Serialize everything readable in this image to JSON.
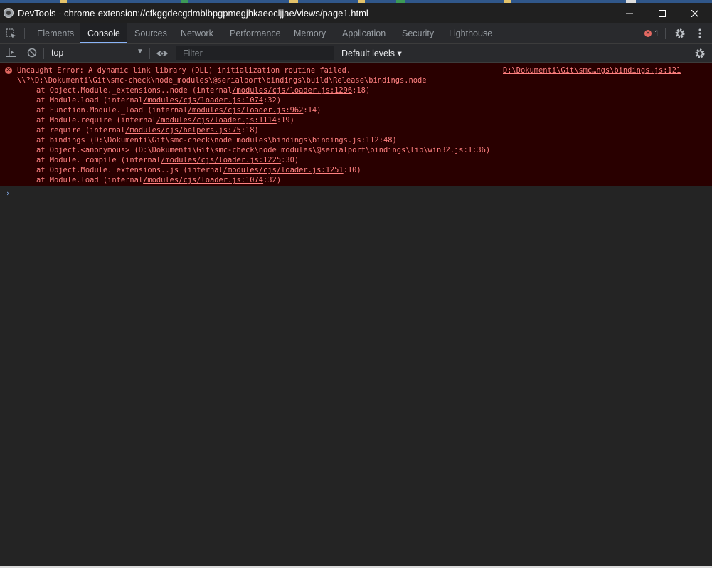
{
  "window": {
    "title": "DevTools - chrome-extension://cfkggdecgdmblbpgpmegjhkaeocljjae/views/page1.html",
    "minimize_symbol": "—",
    "maximize_symbol": "☐",
    "close_symbol": "✕"
  },
  "tabs": [
    {
      "label": "Elements"
    },
    {
      "label": "Console",
      "active": true
    },
    {
      "label": "Sources"
    },
    {
      "label": "Network"
    },
    {
      "label": "Performance"
    },
    {
      "label": "Memory"
    },
    {
      "label": "Application"
    },
    {
      "label": "Security"
    },
    {
      "label": "Lighthouse"
    }
  ],
  "error_count": "1",
  "toolbar": {
    "context": "top",
    "filter_placeholder": "Filter",
    "levels_label": "Default levels ▾"
  },
  "console": {
    "error_message": "Uncaught Error: A dynamic link library (DLL) initialization routine failed.",
    "error_path": "\\\\?\\D:\\Dokumenti\\Git\\smc-check\\node_modules\\@serialport\\bindings\\build\\Release\\bindings.node",
    "source_link": "D:\\Dokumenti\\Git\\smc…ngs\\bindings.js:121",
    "stack": [
      {
        "pre": "at Object.Module._extensions..node (internal",
        "link": "/modules/cjs/loader.js:1296",
        "post": ":18)"
      },
      {
        "pre": "at Module.load (internal",
        "link": "/modules/cjs/loader.js:1074",
        "post": ":32)"
      },
      {
        "pre": "at Function.Module._load (internal",
        "link": "/modules/cjs/loader.js:962",
        "post": ":14)"
      },
      {
        "pre": "at Module.require (internal",
        "link": "/modules/cjs/loader.js:1114",
        "post": ":19)"
      },
      {
        "pre": "at require (internal",
        "link": "/modules/cjs/helpers.js:75",
        "post": ":18)"
      },
      {
        "pre": "at bindings (D:\\Dokumenti\\Git\\smc-check\\node_modules\\bindings\\bindings.js:112:48)",
        "link": "",
        "post": ""
      },
      {
        "pre": "at Object.<anonymous> (D:\\Dokumenti\\Git\\smc-check\\node_modules\\@serialport\\bindings\\lib\\win32.js:1:36)",
        "link": "",
        "post": ""
      },
      {
        "pre": "at Module._compile (internal",
        "link": "/modules/cjs/loader.js:1225",
        "post": ":30)"
      },
      {
        "pre": "at Object.Module._extensions..js (internal",
        "link": "/modules/cjs/loader.js:1251",
        "post": ":10)"
      },
      {
        "pre": "at Module.load (internal",
        "link": "/modules/cjs/loader.js:1074",
        "post": ":32)"
      }
    ],
    "prompt_symbol": "›"
  }
}
